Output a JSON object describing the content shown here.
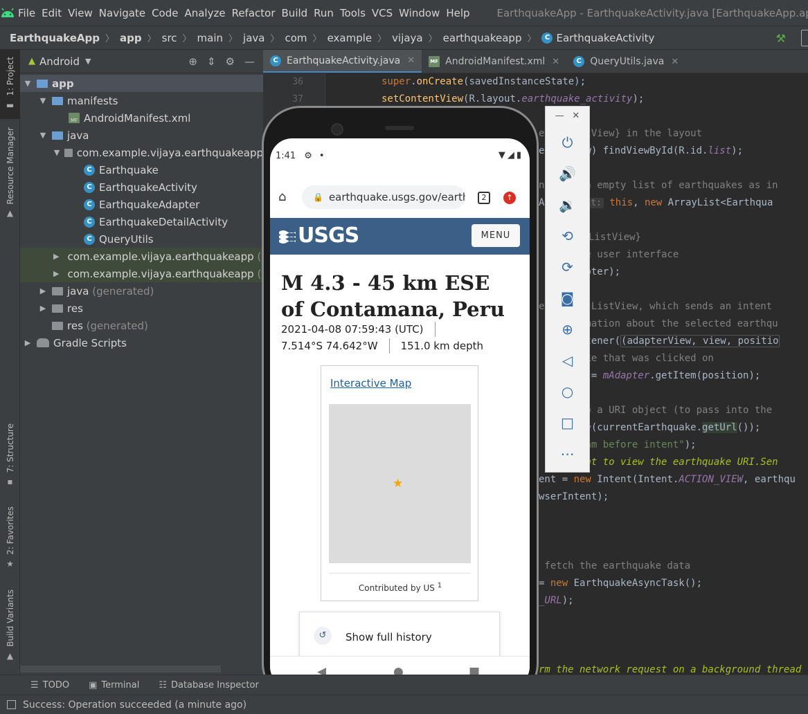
{
  "ide": {
    "window_title": "EarthquakeApp - EarthquakeActivity.java [EarthquakeApp.app]",
    "menu": [
      "File",
      "Edit",
      "View",
      "Navigate",
      "Code",
      "Analyze",
      "Refactor",
      "Build",
      "Run",
      "Tools",
      "VCS",
      "Window",
      "Help"
    ],
    "breadcrumb": [
      "EarthquakeApp",
      "app",
      "src",
      "main",
      "java",
      "com",
      "example",
      "vijaya",
      "earthquakeapp",
      "EarthquakeActivity"
    ]
  },
  "left_strip": {
    "project": "1: Project",
    "resource_manager": "Resource Manager",
    "structure": "7: Structure",
    "favorites": "2: Favorites",
    "build_variants": "Build Variants"
  },
  "project_panel": {
    "view": "Android",
    "tree": [
      {
        "label": "app",
        "dim": ""
      },
      {
        "label": "manifests",
        "dim": ""
      },
      {
        "label": "AndroidManifest.xml",
        "dim": ""
      },
      {
        "label": "java",
        "dim": ""
      },
      {
        "label": "com.example.vijaya.earthquakeapp",
        "dim": ""
      },
      {
        "label": "Earthquake",
        "dim": ""
      },
      {
        "label": "EarthquakeActivity",
        "dim": ""
      },
      {
        "label": "EarthquakeAdapter",
        "dim": ""
      },
      {
        "label": "EarthquakeDetailActivity",
        "dim": ""
      },
      {
        "label": "QueryUtils",
        "dim": ""
      },
      {
        "label": "com.example.vijaya.earthquakeapp",
        "dim": "(ar"
      },
      {
        "label": "com.example.vijaya.earthquakeapp",
        "dim": "(te"
      },
      {
        "label": "java",
        "dim": "(generated)"
      },
      {
        "label": "res",
        "dim": ""
      },
      {
        "label": "res",
        "dim": "(generated)"
      },
      {
        "label": "Gradle Scripts",
        "dim": ""
      }
    ]
  },
  "editor": {
    "tabs": [
      {
        "label": "EarthquakeActivity.java",
        "icon": "C"
      },
      {
        "label": "AndroidManifest.xml",
        "icon": "MF"
      },
      {
        "label": "QueryUtils.java",
        "icon": "C"
      }
    ],
    "line_numbers": [
      "36",
      "37"
    ]
  },
  "bottom_tools": {
    "todo": "TODO",
    "terminal": "Terminal",
    "db": "Database Inspector"
  },
  "status": {
    "text": "Success: Operation succeeded (a minute ago)"
  },
  "phone": {
    "time": "1:41",
    "url": "earthquake.usgs.gov/earthc",
    "tab_count": "2",
    "logo": "USGS",
    "menu": "MENU",
    "title": "M 4.3 - 45 km ESE of Contamana, Peru",
    "datetime": "2021-04-08 07:59:43 (UTC)",
    "coords": "7.514°S 74.642°W",
    "depth": "151.0 km depth",
    "map_link": "Interactive Map",
    "credit": "Contributed by US",
    "credit_sup": "1",
    "history": "Show full history"
  }
}
